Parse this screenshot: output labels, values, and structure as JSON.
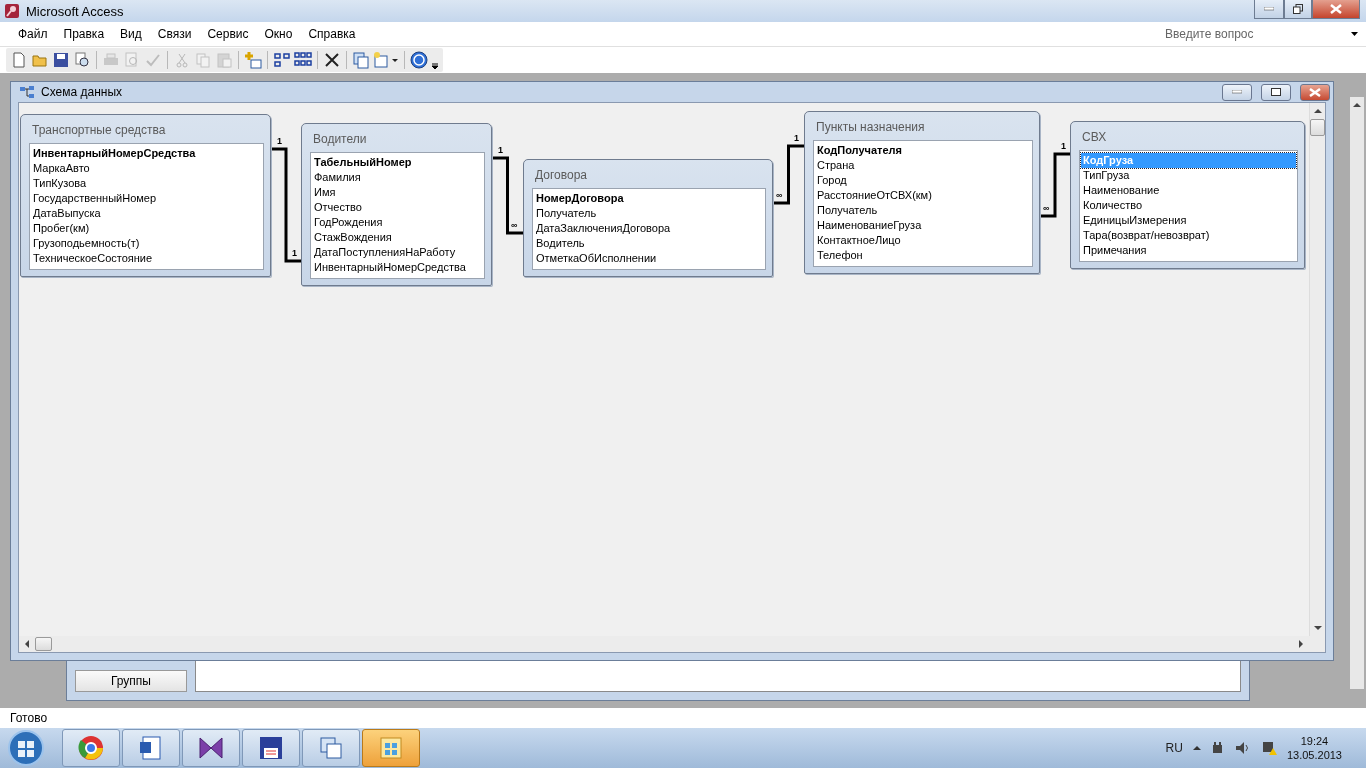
{
  "app_title": "Microsoft Access",
  "menu": [
    "Файл",
    "Правка",
    "Вид",
    "Связи",
    "Сервис",
    "Окно",
    "Справка"
  ],
  "help_search": {
    "placeholder": "Введите вопрос"
  },
  "toolbar": [
    {
      "kind": "new",
      "disabled": false
    },
    {
      "kind": "open",
      "disabled": false
    },
    {
      "kind": "save",
      "disabled": false
    },
    {
      "kind": "file-search",
      "disabled": false
    },
    {
      "kind": "separator"
    },
    {
      "kind": "print",
      "disabled": true
    },
    {
      "kind": "preview",
      "disabled": true
    },
    {
      "kind": "spelling",
      "disabled": true
    },
    {
      "kind": "separator"
    },
    {
      "kind": "cut",
      "disabled": true
    },
    {
      "kind": "copy",
      "disabled": true
    },
    {
      "kind": "paste",
      "disabled": true
    },
    {
      "kind": "separator"
    },
    {
      "kind": "show-table",
      "disabled": false
    },
    {
      "kind": "separator"
    },
    {
      "kind": "direct-relations",
      "disabled": false
    },
    {
      "kind": "all-relations",
      "disabled": false
    },
    {
      "kind": "separator"
    },
    {
      "kind": "delete",
      "disabled": false
    },
    {
      "kind": "separator"
    },
    {
      "kind": "database-window",
      "disabled": false
    },
    {
      "kind": "new-object",
      "disabled": false
    },
    {
      "kind": "separator"
    },
    {
      "kind": "help",
      "disabled": false
    }
  ],
  "diagram_window": {
    "title": "Схема данных"
  },
  "tables": [
    {
      "name": "Транспортные средства",
      "fields": [
        {
          "name": "ИнвентарныйНомерСредства",
          "key": true,
          "selected": false
        },
        {
          "name": "МаркаАвто",
          "key": false,
          "selected": false
        },
        {
          "name": "ТипКузова",
          "key": false,
          "selected": false
        },
        {
          "name": "ГосударственныйНомер",
          "key": false,
          "selected": false
        },
        {
          "name": "ДатаВыпуска",
          "key": false,
          "selected": false
        },
        {
          "name": "Пробег(км)",
          "key": false,
          "selected": false
        },
        {
          "name": "Грузоподьемность(т)",
          "key": false,
          "selected": false
        },
        {
          "name": "ТехническоеСостояние",
          "key": false,
          "selected": false
        }
      ]
    },
    {
      "name": "Водители",
      "fields": [
        {
          "name": "ТабельныйНомер",
          "key": true,
          "selected": false
        },
        {
          "name": "Фамилия",
          "key": false,
          "selected": false
        },
        {
          "name": "Имя",
          "key": false,
          "selected": false
        },
        {
          "name": "Отчество",
          "key": false,
          "selected": false
        },
        {
          "name": "ГодРождения",
          "key": false,
          "selected": false
        },
        {
          "name": "СтажВождения",
          "key": false,
          "selected": false
        },
        {
          "name": "ДатаПоступленияНаРаботу",
          "key": false,
          "selected": false
        },
        {
          "name": "ИнвентарныйНомерСредства",
          "key": false,
          "selected": false
        }
      ]
    },
    {
      "name": "Договора",
      "fields": [
        {
          "name": "НомерДоговора",
          "key": true,
          "selected": false
        },
        {
          "name": "Получатель",
          "key": false,
          "selected": false
        },
        {
          "name": "ДатаЗаключенияДоговора",
          "key": false,
          "selected": false
        },
        {
          "name": "Водитель",
          "key": false,
          "selected": false
        },
        {
          "name": "ОтметкаОбИсполнении",
          "key": false,
          "selected": false
        }
      ]
    },
    {
      "name": "Пункты назначения",
      "fields": [
        {
          "name": "КодПолучателя",
          "key": true,
          "selected": false
        },
        {
          "name": "Страна",
          "key": false,
          "selected": false
        },
        {
          "name": "Город",
          "key": false,
          "selected": false
        },
        {
          "name": "РасстояниеОтСВХ(км)",
          "key": false,
          "selected": false
        },
        {
          "name": "Получатель",
          "key": false,
          "selected": false
        },
        {
          "name": "НаименованиеГруза",
          "key": false,
          "selected": false
        },
        {
          "name": "КонтактноеЛицо",
          "key": false,
          "selected": false
        },
        {
          "name": "Телефон",
          "key": false,
          "selected": false
        }
      ]
    },
    {
      "name": "СВХ",
      "fields": [
        {
          "name": "КодГруза",
          "key": true,
          "selected": true
        },
        {
          "name": "ТипГруза",
          "key": false,
          "selected": false
        },
        {
          "name": "Наименование",
          "key": false,
          "selected": false
        },
        {
          "name": "Количество",
          "key": false,
          "selected": false
        },
        {
          "name": "ЕдиницыИзмерения",
          "key": false,
          "selected": false
        },
        {
          "name": "Тара(возврат/невозврат)",
          "key": false,
          "selected": false
        },
        {
          "name": "Примечания",
          "key": false,
          "selected": false
        }
      ]
    }
  ],
  "relationships": [
    {
      "from_label": "1",
      "to_label": "1"
    },
    {
      "from_label": "1",
      "to_label": "∞"
    },
    {
      "from_label": "∞",
      "to_label": "1"
    },
    {
      "from_label": "∞",
      "to_label": "1"
    }
  ],
  "db_window": {
    "button": "Группы"
  },
  "status_bar": "Готово",
  "taskbar": {
    "apps": [
      {
        "kind": "browser",
        "selected": false
      },
      {
        "kind": "word",
        "selected": false
      },
      {
        "kind": "bowtie",
        "selected": false
      },
      {
        "kind": "floppy",
        "selected": false
      },
      {
        "kind": "windows",
        "selected": false
      },
      {
        "kind": "access",
        "selected": true
      }
    ],
    "language": "RU",
    "time": "19:24",
    "date": "13.05.2013"
  }
}
